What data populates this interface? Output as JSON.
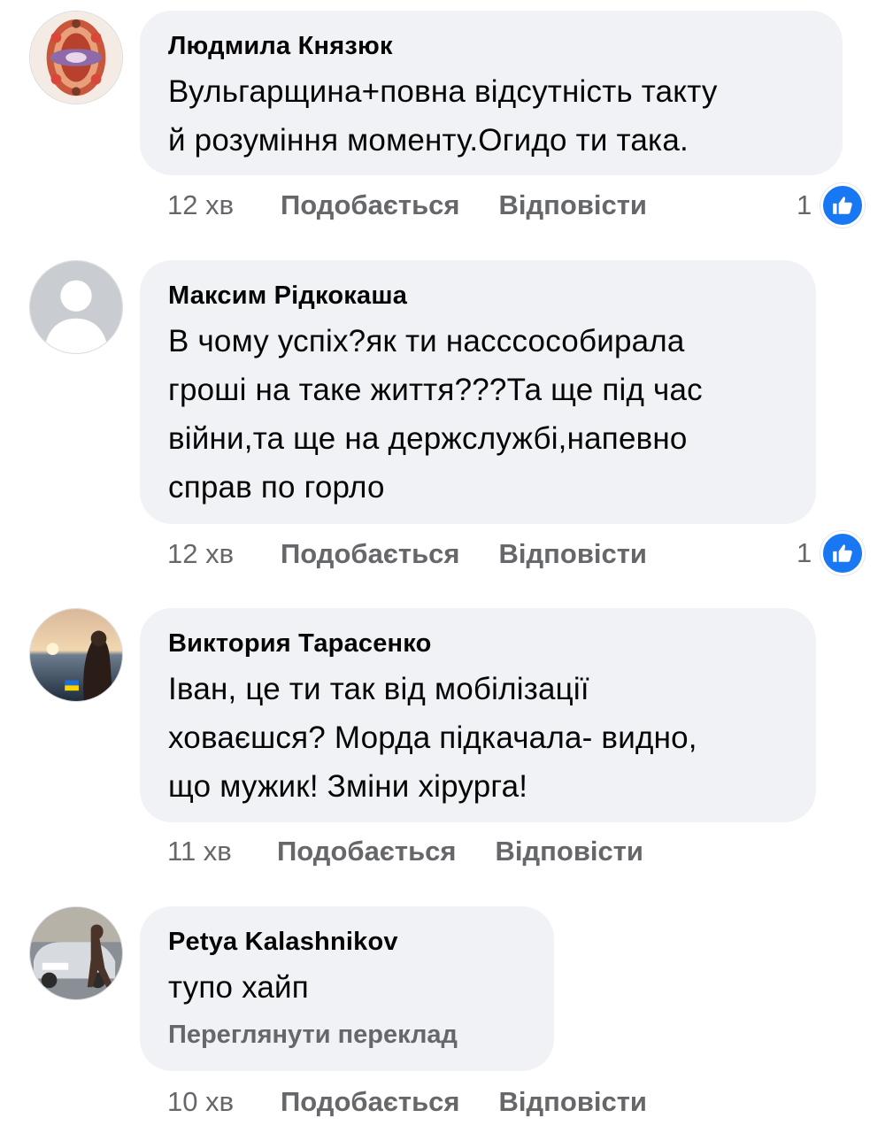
{
  "comments": [
    {
      "author": "Людмила Князюк",
      "text": "Вульгарщина+повна відсутність такту\nй розуміння моменту.Огидо ти така.",
      "time": "12 хв",
      "like_label": "Подобається",
      "reply_label": "Відповісти",
      "reaction_count": "1",
      "avatar_icon": "ornament-avatar"
    },
    {
      "author": "Максим Рідкокаша",
      "text": "В чому успіх?як ти насссособирала\nгроші на таке життя???Та ще під час\nвійни,та ще на держслужбі,напевно\nсправ по горло",
      "time": "12 хв",
      "like_label": "Подобається",
      "reply_label": "Відповісти",
      "reaction_count": "1",
      "avatar_icon": "default-user-avatar"
    },
    {
      "author": "Виктория Тарасенко",
      "text": "Іван,  це ти так від мобілізації\nховаєшся? Морда підкачала- видно,\nщо мужик! Зміни хірурга!",
      "time": "11 хв",
      "like_label": "Подобається",
      "reply_label": "Відповісти",
      "avatar_icon": "sunset-photo-avatar"
    },
    {
      "author": "Petya  Kalashnikov",
      "text": "тупо хайп",
      "translate_label": "Переглянути переклад",
      "time": "10 хв",
      "like_label": "Подобається",
      "reply_label": "Відповісти",
      "avatar_icon": "car-photo-avatar"
    }
  ],
  "colors": {
    "bubble_bg": "#f0f2f5",
    "secondary_text": "#65676b",
    "like_blue": "#1877f2"
  }
}
